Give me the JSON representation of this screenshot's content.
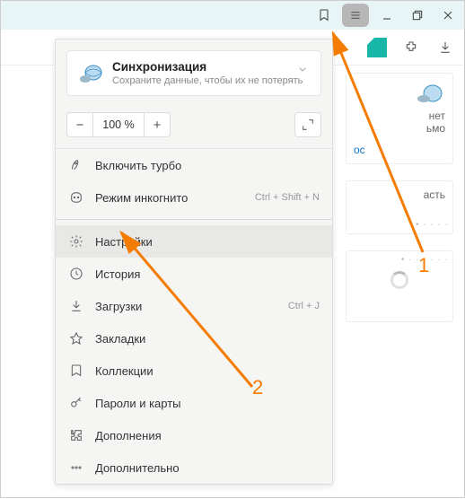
{
  "titlebar": {
    "bookmark_icon": "bookmark",
    "menu_icon": "hamburger",
    "minimize_icon": "minimize",
    "restore_icon": "restore",
    "close_icon": "close"
  },
  "toolbar": {
    "tile_icon": "app-tile",
    "extensions_icon": "extensions",
    "downloads_icon": "download"
  },
  "sync": {
    "title": "Синхронизация",
    "subtitle": "Сохраните данные, чтобы их не потерять"
  },
  "zoom": {
    "minus": "−",
    "value": "100 %",
    "plus": "+"
  },
  "menu": {
    "turbo": "Включить турбо",
    "incognito": "Режим инкогнито",
    "incognito_shortcut": "Ctrl + Shift + N",
    "settings": "Настройки",
    "history": "История",
    "downloads": "Загрузки",
    "downloads_shortcut": "Ctrl + J",
    "bookmarks": "Закладки",
    "collections": "Коллекции",
    "passwords": "Пароли и карты",
    "addons": "Дополнения",
    "more": "Дополнительно"
  },
  "bg": {
    "txt1": "нет",
    "txt2": "ьмо",
    "link1": "ос",
    "txt3": "асть"
  },
  "annotations": {
    "one": "1",
    "two": "2"
  }
}
